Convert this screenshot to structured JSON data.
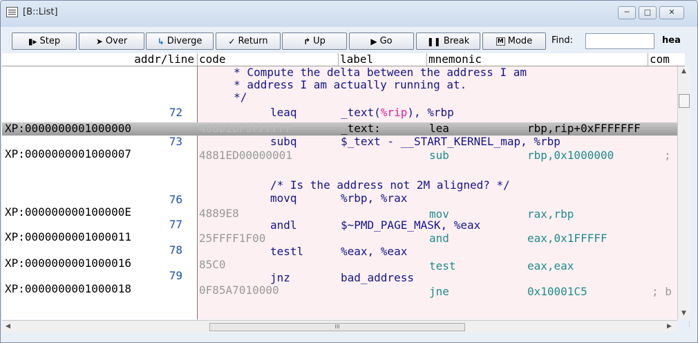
{
  "window": {
    "title": "[B::List]"
  },
  "toolbar": {
    "step": {
      "icon": "step-icon",
      "label": "Step"
    },
    "over": {
      "icon": "step-over-icon",
      "label": "Over"
    },
    "diverge": {
      "icon": "diverge-icon",
      "label": "Diverge"
    },
    "return": {
      "icon": "return-icon",
      "label": "Return"
    },
    "up": {
      "icon": "up-icon",
      "label": "Up"
    },
    "go": {
      "icon": "go-icon",
      "label": "Go"
    },
    "break": {
      "icon": "break-icon",
      "label": "Break"
    },
    "mode": {
      "icon": "mode-icon",
      "label": "Mode"
    },
    "find_label": "Find:",
    "find_value": "",
    "search_hint": "hea"
  },
  "columns": [
    "addr/line",
    "code",
    "label",
    "mnemonic",
    "com"
  ],
  "listing": {
    "comment1": "     * Compute the delta between the address I am",
    "comment2": "     * address I am actually running at.",
    "comment3": "     */",
    "l72_num": "72",
    "l72_mn": "leaq",
    "l72_op_pre": "_text(",
    "l72_op_reg": "%rip",
    "l72_op_post": "), %rbp",
    "row1_addr": "XP:0000000001000000",
    "row1_code": "488D2DF9FFFFFF",
    "row1_label": "_text:",
    "row1_mn": "lea",
    "row1_ops": "rbp,rip+0xFFFFFFF",
    "l73_num": "73",
    "l73_mn": "subq",
    "l73_op": "$_text - __START_KERNEL_map, %rbp",
    "row2_addr": "XP:0000000001000007",
    "row2_code": "4881ED00000001",
    "row2_mn": "sub",
    "row2_ops": "rbp,0x1000000",
    "row2_cmt": ";",
    "comment4": "/* Is the address not 2M aligned? */",
    "l76_num": "76",
    "l76_mn": "movq",
    "l76_op": "%rbp, %rax",
    "row3_addr": "XP:000000000100000E",
    "row3_code": "4889E8",
    "row3_mn": "mov",
    "row3_ops": "rax,rbp",
    "l77_num": "77",
    "l77_mn": "andl",
    "l77_op": "$~PMD_PAGE_MASK, %eax",
    "row4_addr": "XP:0000000001000011",
    "row4_code": "25FFFF1F00",
    "row4_mn": "and",
    "row4_ops": "eax,0x1FFFFF",
    "l78_num": "78",
    "l78_mn": "testl",
    "l78_op": "%eax, %eax",
    "row5_addr": "XP:0000000001000016",
    "row5_code": "85C0",
    "row5_mn": "test",
    "row5_ops": "eax,eax",
    "l79_num": "79",
    "l79_mn": "jnz",
    "l79_op": "bad_address",
    "row6_addr": "XP:0000000001000018",
    "row6_code": "0F85A7010000",
    "row6_mn": "jne",
    "row6_ops": "0x10001C5",
    "row6_cmt": "; b"
  },
  "scrollbar": {
    "h_thumb_grip": "III"
  }
}
